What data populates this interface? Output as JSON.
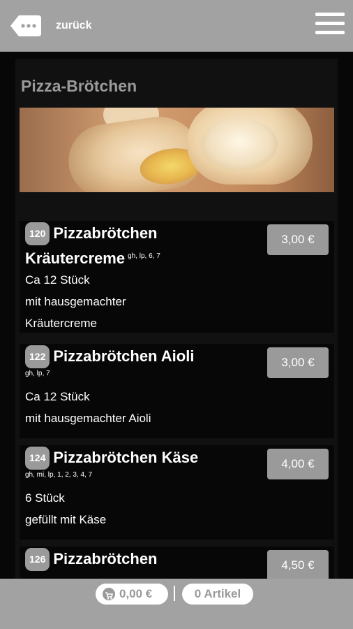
{
  "header": {
    "back_label": "zurück",
    "back_icon": "ellipsis-back-icon",
    "menu_icon": "hamburger-menu-icon"
  },
  "category": {
    "title": "Pizza-Brötchen",
    "image": "pizza-rolls-photo"
  },
  "items": [
    {
      "number": "120",
      "name_line1": "Pizzabrötchen",
      "name_line2": "Kräutercreme",
      "allergens": "gh, lp, 6, 7",
      "desc1": "Ca 12 Stück",
      "desc2": "mit hausgemachter",
      "desc3": "Kräutercreme",
      "price": "3,00 €"
    },
    {
      "number": "122",
      "name": "Pizzabrötchen Aioli",
      "allergens": "gh, lp, 7",
      "desc1": "Ca 12 Stück",
      "desc2": "mit hausgemachter Aioli",
      "price": "3,00 €"
    },
    {
      "number": "124",
      "name": "Pizzabrötchen Käse",
      "allergens": "gh, mi, lp, 1, 2, 3, 4, 7",
      "desc1": "6 Stück",
      "desc2": "gefüllt mit Käse",
      "price": "4,00 €"
    },
    {
      "number": "126",
      "name": "Pizzabrötchen",
      "price": "4,50 €"
    }
  ],
  "cart": {
    "total": "0,00 €",
    "articles": "0 Artikel",
    "cart_icon": "cart-icon"
  },
  "colors": {
    "bar": "#a2a2a2",
    "badge": "#9a9a9a",
    "background": "#070707"
  }
}
